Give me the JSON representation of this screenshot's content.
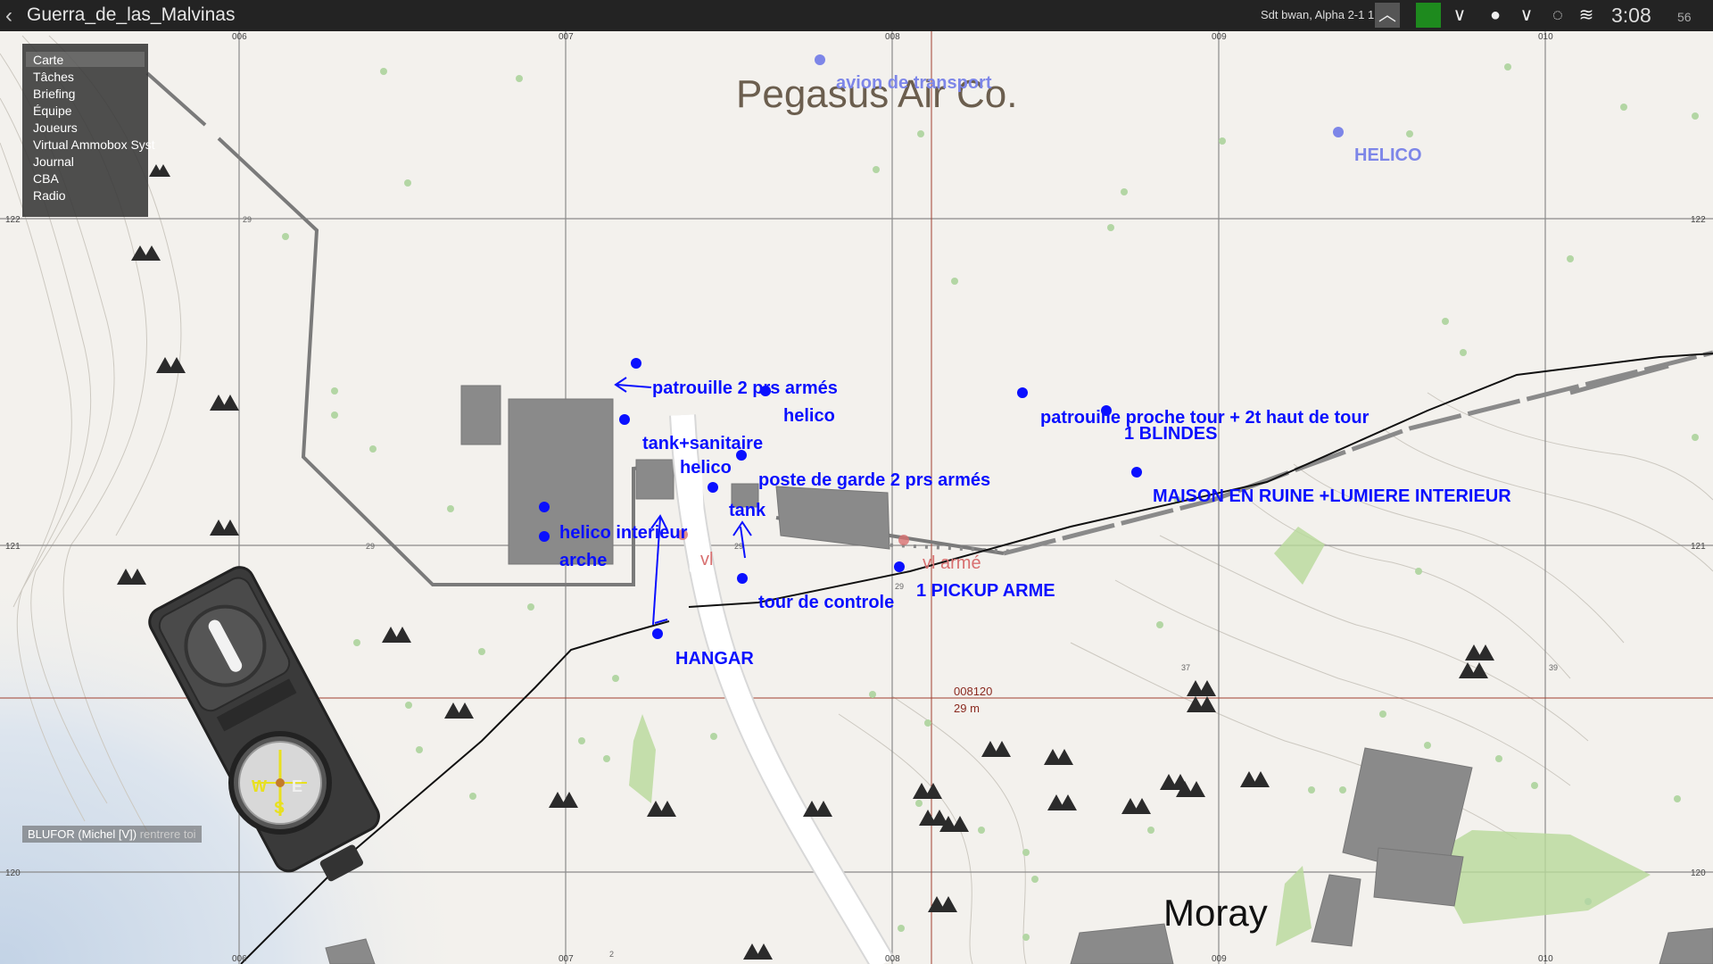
{
  "window": {
    "title": "Guerra_de_las_Malvinas",
    "player": "Sdt bwan, Alpha 2-1 1",
    "time": "3:08",
    "seconds": "56"
  },
  "menu": {
    "items": [
      "Carte",
      "Tâches",
      "Briefing",
      "Équipe",
      "Joueurs",
      "Virtual Ammobox Syst",
      "Journal",
      "CBA",
      "Radio"
    ]
  },
  "map": {
    "grid_top": [
      "006",
      "007",
      "008",
      "009",
      "010"
    ],
    "grid_bottom": [
      "006",
      "007",
      "008",
      "009",
      "010"
    ],
    "grid_side": [
      "122",
      "121",
      "120"
    ],
    "elevations": [
      "29",
      "29",
      "29",
      "29",
      "37",
      "39",
      "2"
    ],
    "location_labels": {
      "airfield": "Pegasus Air Co.",
      "town": "Moray"
    },
    "cursor": {
      "grid": "008120",
      "distance": "29 m"
    }
  },
  "markers": [
    {
      "text": "avion de transport",
      "color": "#7d86e8"
    },
    {
      "text": "HELICO",
      "color": "#7d86e8"
    },
    {
      "text": "patrouille 2 prs armés",
      "color": "#0a10ff"
    },
    {
      "text": "helico",
      "color": "#0a10ff"
    },
    {
      "text": "tank+sanitaire",
      "color": "#0a10ff"
    },
    {
      "text": "helico",
      "color": "#0a10ff"
    },
    {
      "text": "poste de garde 2 prs armés",
      "color": "#0a10ff"
    },
    {
      "text": "tank",
      "color": "#0a10ff"
    },
    {
      "text": "helico interieur",
      "color": "#0a10ff"
    },
    {
      "text": "arche",
      "color": "#0a10ff"
    },
    {
      "text": "tour de controle",
      "color": "#0a10ff"
    },
    {
      "text": "HANGAR",
      "color": "#0a10ff"
    },
    {
      "text": "patrouille proche tour + 2t haut de tour",
      "color": "#0a10ff"
    },
    {
      "text": "1 BLINDES",
      "color": "#0a10ff"
    },
    {
      "text": "MAISON EN RUINE +LUMIERE INTERIEUR",
      "color": "#0a10ff"
    },
    {
      "text": "1 PICKUP ARME",
      "color": "#0a10ff"
    },
    {
      "text": "vl",
      "color": "#d87070"
    },
    {
      "text": "vl armé",
      "color": "#d87070"
    }
  ],
  "chat": {
    "sender": "BLUFOR (Michel [V])",
    "message": "rentrere toi"
  },
  "compass": {
    "west": "W",
    "east": "E",
    "south": "S"
  },
  "colors": {
    "friendly_marker": "#0a10ff",
    "faded_marker": "#7d86e8",
    "vehicle_marker": "#d87070",
    "cursor_line": "#a04030",
    "topbar": "#232323",
    "green_status": "#1e8a1e"
  }
}
